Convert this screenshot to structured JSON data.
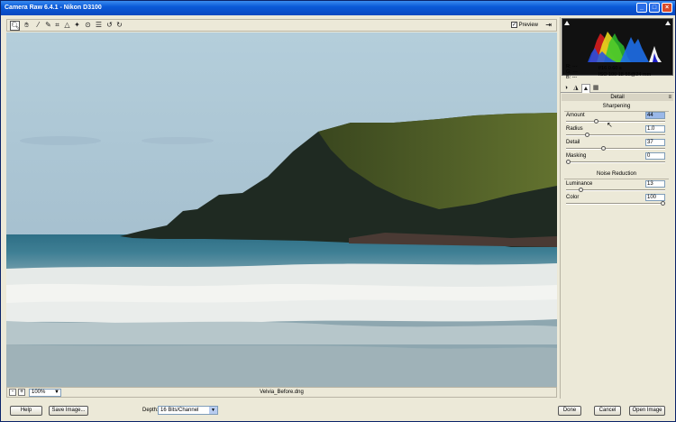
{
  "window": {
    "title": "Camera Raw 6.4.1  -  Nikon D3100"
  },
  "toolbar": {
    "tools": [
      "zoom-icon",
      "hand-icon",
      "white-balance-icon",
      "color-sampler-icon",
      "crop-icon",
      "straighten-icon",
      "spot-removal-icon",
      "red-eye-icon",
      "preferences-icon",
      "rotate-left-icon",
      "rotate-right-icon"
    ],
    "preview_label": "Preview",
    "preview_checked": "✓"
  },
  "status": {
    "zoom": "100%",
    "filename": "Velvia_Before.dng",
    "minus": "-",
    "plus": "+"
  },
  "histogram": {
    "readout": {
      "r": "R:  ---",
      "g": "G:  ---",
      "b": "B:  ---"
    },
    "exif": {
      "line1": "f/16   0.60 s",
      "line2": "ISO 100   18-55@24 mm"
    }
  },
  "panel": {
    "title": "Detail",
    "sharpening": {
      "heading": "Sharpening",
      "sliders": [
        {
          "label": "Amount",
          "value": "44",
          "level": 0.293
        },
        {
          "label": "Radius",
          "value": "1.0",
          "level": 0.2
        },
        {
          "label": "Detail",
          "value": "37",
          "level": 0.37
        },
        {
          "label": "Masking",
          "value": "0",
          "level": 0.0
        }
      ]
    },
    "noise": {
      "heading": "Noise Reduction",
      "sliders": [
        {
          "label": "Luminance",
          "value": "13",
          "level": 0.13
        },
        {
          "label": "Color",
          "value": "100",
          "level": 1.0
        }
      ]
    }
  },
  "bottom": {
    "help": "Help",
    "save": "Save Image...",
    "depth_label": "Depth:",
    "depth_value": "16 Bits/Channel",
    "done": "Done",
    "cancel": "Cancel",
    "open": "Open Image"
  }
}
